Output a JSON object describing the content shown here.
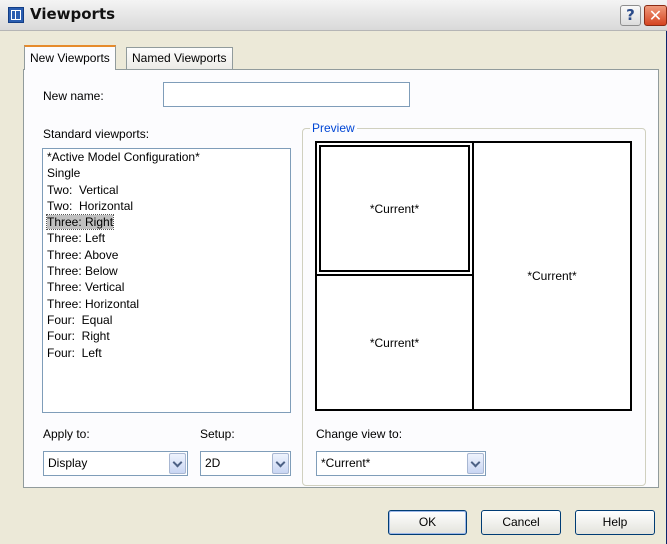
{
  "window": {
    "title": "Viewports",
    "help_glyph": "?",
    "close_glyph": "✕"
  },
  "tabs": [
    {
      "label": "New Viewports",
      "active": true
    },
    {
      "label": "Named Viewports",
      "active": false
    }
  ],
  "new_name": {
    "label": "New name:",
    "value": ""
  },
  "standard_viewports": {
    "label": "Standard viewports:",
    "items": [
      "*Active Model Configuration*",
      "Single",
      "Two:  Vertical",
      "Two:  Horizontal",
      "Three: Right",
      "Three: Left",
      "Three: Above",
      "Three: Below",
      "Three: Vertical",
      "Three: Horizontal",
      "Four:  Equal",
      "Four:  Right",
      "Four:  Left"
    ],
    "selected": "Three: Right"
  },
  "preview": {
    "title": "Preview",
    "panes": [
      "*Current*",
      "*Current*",
      "*Current*"
    ]
  },
  "apply_to": {
    "label": "Apply to:",
    "value": "Display"
  },
  "setup": {
    "label": "Setup:",
    "value": "2D"
  },
  "change_view": {
    "label": "Change view to:",
    "value": "*Current*"
  },
  "buttons": {
    "ok": "OK",
    "cancel": "Cancel",
    "help": "Help"
  },
  "colors": {
    "selected_tab_accent": "#e68b2c",
    "group_title": "#0046d5",
    "close_button": "#d54421"
  }
}
